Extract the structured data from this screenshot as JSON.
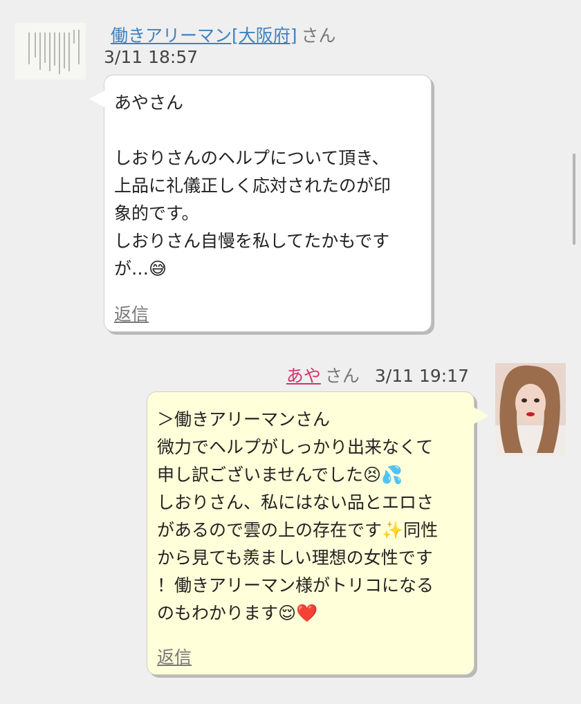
{
  "messages": [
    {
      "sender": "働きアリーマン[大阪府]",
      "suffix": "さん",
      "timestamp": "3/11 18:57",
      "lines": [
        "あやさん",
        "",
        "しおりさんのヘルプについて頂き、",
        "上品に礼儀正しく応対されたのが印",
        "象的です。",
        "しおりさん自慢を私してたかもです",
        "が…😅"
      ],
      "reply_label": "返信"
    },
    {
      "sender": "あや",
      "suffix": "さん",
      "timestamp": "3/11 19:17",
      "lines": [
        "＞働きアリーマンさん",
        "微力でヘルプがしっかり出来なくて",
        "申し訳ございませんでした😣💦",
        "しおりさん、私にはない品とエロさ",
        "があるので雲の上の存在です✨同性",
        "から見ても羨ましい理想の女性です",
        "！働きアリーマン様がトリコになる",
        "のもわかります😌❤️"
      ],
      "reply_label": "返信"
    }
  ]
}
